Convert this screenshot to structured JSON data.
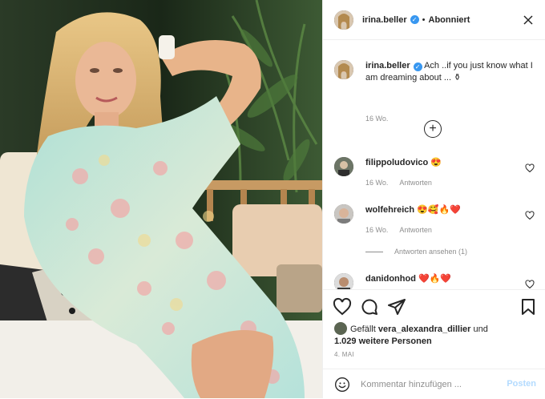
{
  "post": {
    "username": "irina.beller",
    "follow_state": "Abonniert",
    "separator": "•",
    "verified_mark": "✓",
    "more_icon": "more-icon"
  },
  "caption": {
    "username": "irina.beller",
    "text": "Ach ..if you just know what I am dreaming about ... ⚱",
    "time": "16 Wo."
  },
  "load_more_icon": "+",
  "comments": [
    {
      "username": "filippoludovico",
      "text": "😍",
      "time": "16 Wo.",
      "reply_label": "Antworten"
    },
    {
      "username": "wolfehreich",
      "text": "😍🥰🔥❤️",
      "time": "16 Wo.",
      "reply_label": "Antworten"
    },
    {
      "username": "danidonhod",
      "text": "❤️🔥❤️"
    }
  ],
  "view_replies": "Antworten ansehen (1)",
  "likes": {
    "prefix": "Gefällt",
    "user": "vera_alexandra_dillier",
    "middle": "und",
    "count": "1.029 weitere Personen"
  },
  "date": "4. MAI",
  "add_comment": {
    "placeholder": "Kommentar hinzufügen ...",
    "post_label": "Posten"
  },
  "colors": {
    "accent": "#3897f0",
    "post_button_disabled": "#b3dbff",
    "muted_text": "#8e8e8e",
    "text": "#262626",
    "border": "#efefef"
  }
}
